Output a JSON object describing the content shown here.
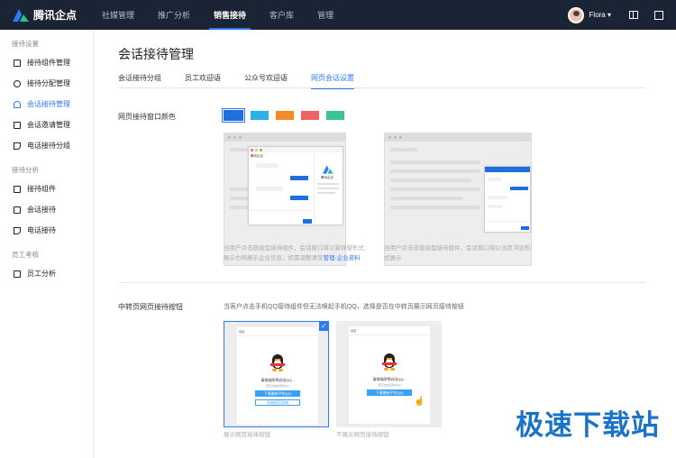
{
  "app": {
    "name": "腾讯企点"
  },
  "topnav": {
    "items": [
      "社媒管理",
      "推广分析",
      "销售接待",
      "客户库",
      "管理"
    ],
    "active_index": 2
  },
  "user": {
    "name": "Flora ▾"
  },
  "sidebar": {
    "groups": [
      {
        "title": "接待设置",
        "items": [
          {
            "label": "接待组件管理",
            "icon": "widget-icon"
          },
          {
            "label": "接待分配管理",
            "icon": "share-icon"
          },
          {
            "label": "会话接待管理",
            "icon": "headset-icon",
            "active": true
          },
          {
            "label": "会话邀请管理",
            "icon": "chat-invite-icon"
          },
          {
            "label": "电话接待分组",
            "icon": "phone-icon"
          }
        ]
      },
      {
        "title": "接待分析",
        "items": [
          {
            "label": "接待组件",
            "icon": "widget-icon"
          },
          {
            "label": "会话接待",
            "icon": "chat-icon"
          },
          {
            "label": "电话接待",
            "icon": "phone-icon"
          }
        ]
      },
      {
        "title": "员工考核",
        "items": [
          {
            "label": "员工分析",
            "icon": "clipboard-icon"
          }
        ]
      }
    ]
  },
  "page": {
    "title": "会话接待管理",
    "tabs": [
      "会话接待分组",
      "员工欢迎语",
      "公众号欢迎语",
      "网页会话设置"
    ],
    "active_tab": 3
  },
  "window_color": {
    "label": "网页接待窗口颜色",
    "swatches": [
      "#1f6fe0",
      "#2db2e8",
      "#f58a2a",
      "#ef6261",
      "#3cc295"
    ],
    "selected_index": 0,
    "caption_left": "当用户点击链接型接待组件，会话窗口将以新弹窗形式展示右侧展示企业信息，如需调整请至",
    "caption_left_link": "管理-企业资料",
    "caption_right": "当用户点击非链接型接待组件，会话窗口将以当页浮层形式展示",
    "preview": {
      "company": "腾讯企点",
      "mini_title": "腾讯企点"
    }
  },
  "transfer": {
    "label": "中转页网页接待按钮",
    "desc": "当客户点击手机QQ接待组件但无法唤起手机QQ，选择是否在中转页展示网页接待按钮",
    "options": [
      {
        "caption": "展示网页接待按钮",
        "selected": true
      },
      {
        "caption": "不展示网页接待按钮",
        "selected": false
      }
    ],
    "card": {
      "qq": "QQ",
      "prompt": "请稍候即将启动QQ...",
      "hint": "若无法启动手机QQ",
      "download": "下载最新手机QQ",
      "web": "开始网页咨询"
    }
  },
  "watermark": "极速下载站"
}
